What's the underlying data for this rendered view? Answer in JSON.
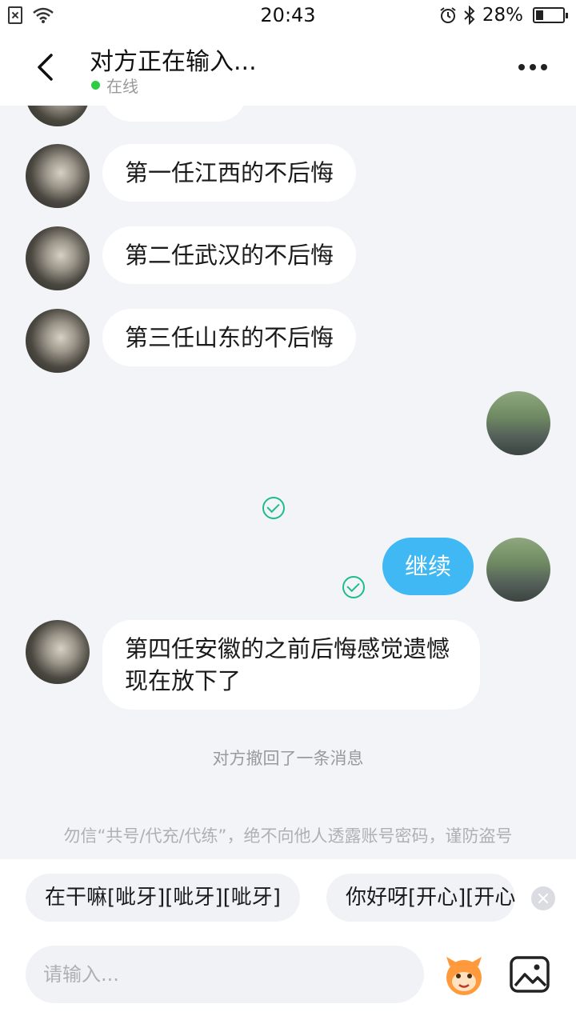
{
  "status_bar": {
    "time": "20:43",
    "battery_percent": "28%",
    "battery_level": 0.28,
    "icons": [
      "no-sim-icon",
      "wifi-icon",
      "alarm-icon",
      "bluetooth-icon",
      "battery-icon"
    ]
  },
  "header": {
    "title": "对方正在输入...",
    "status": "在线",
    "status_color": "#2ecc40",
    "icons": [
      "back-arrow-icon",
      "more-dots-icon"
    ]
  },
  "messages": [
    {
      "from": "other",
      "text": "第一任江西的不后悔"
    },
    {
      "from": "other",
      "text": "第二任武汉的不后悔"
    },
    {
      "from": "other",
      "text": "第三任山东的不后悔"
    },
    {
      "from": "me",
      "text": "继续"
    },
    {
      "from": "other",
      "text": "第四任安徽的之前后悔感觉遗憾 现在放下了"
    }
  ],
  "system": {
    "recall_notice": "对方撤回了一条消息",
    "warning": "勿信“共号/代充/代练”，绝不向他人透露账号密码，谨防盗号"
  },
  "quick_replies": [
    "在干嘛[呲牙][呲牙][呲牙]",
    "你好呀[开心][开心]"
  ],
  "input": {
    "placeholder": "请输入...",
    "icons": [
      "emoji-icon",
      "image-icon"
    ]
  },
  "colors": {
    "accent_bubble": "#3fb8f4",
    "check": "#1ebc8a",
    "background": "#f3f4f8"
  }
}
